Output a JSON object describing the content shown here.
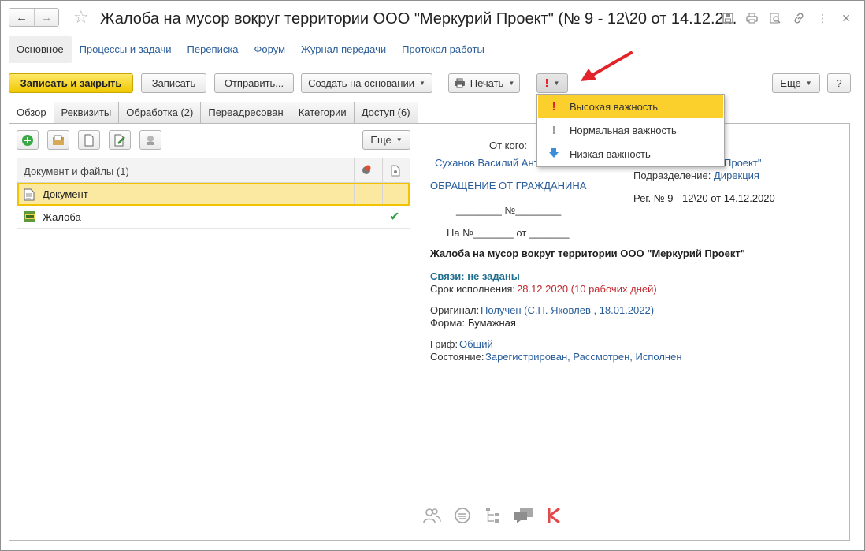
{
  "window": {
    "title": "Жалоба на мусор вокруг территории ООО \"Меркурий Проект\" (№ 9 - 12\\20 от 14.12.2..."
  },
  "section_tabs": [
    {
      "label": "Основное"
    },
    {
      "label": "Процессы и задачи"
    },
    {
      "label": "Переписка"
    },
    {
      "label": "Форум"
    },
    {
      "label": "Журнал передачи"
    },
    {
      "label": "Протокол работы"
    }
  ],
  "toolbar": {
    "save_close": "Записать и закрыть",
    "save": "Записать",
    "send": "Отправить...",
    "create_based": "Создать на основании",
    "print": "Печать",
    "importance_glyph": "!",
    "more": "Еще",
    "help": "?"
  },
  "importance_menu": {
    "items": [
      {
        "label": "Высокая важность",
        "icon": "exclamation-red-icon",
        "color": "#e0202a"
      },
      {
        "label": "Нормальная важность",
        "icon": "exclamation-gray-icon",
        "color": "#9a9a9a"
      },
      {
        "label": "Низкая важность",
        "icon": "arrow-down-blue-icon",
        "color": "#3a8fd8"
      }
    ]
  },
  "inner_tabs": [
    {
      "label": "Обзор"
    },
    {
      "label": "Реквизиты"
    },
    {
      "label": "Обработка (2)"
    },
    {
      "label": "Переадресован"
    },
    {
      "label": "Категории"
    },
    {
      "label": "Доступ (6)"
    }
  ],
  "files": {
    "more": "Еще",
    "header": "Документ и файлы (1)",
    "rows": [
      {
        "name": "Документ"
      },
      {
        "name": "Жалоба"
      }
    ]
  },
  "preview": {
    "from_label": "От кого:",
    "from_name": "Суханов Василий Ант",
    "org_partial": "Проект\"",
    "dept_label": "Подразделение:",
    "dept_value": "Дирекция",
    "appeal_type": "ОБРАЩЕНИЕ ОТ ГРАЖДАНИНА",
    "reg": "Рег. № 9 - 12\\20 от 14.12.2020",
    "num_line": "________ №________",
    "ref_line": "На №_______  от _______",
    "subject": "Жалоба на мусор вокруг территории ООО \"Меркурий Проект\"",
    "links": "Связи: не заданы",
    "deadline_label": "Срок исполнения:",
    "deadline_value": "28.12.2020 (10 рабочих дней)",
    "original_label": "Оригинал:",
    "original_value": "Получен (С.П. Яковлев , 18.01.2022)",
    "form_label": "Форма:",
    "form_value": "Бумажная",
    "grif_label": "Гриф:",
    "grif_value": "Общий",
    "state_label": "Состояние:",
    "state_value": "Зарегистрирован, Рассмотрен, Исполнен"
  },
  "bottom_icons": [
    "people-icon",
    "circle-lines-icon",
    "tree-icon",
    "chat-icon",
    "k-logo-icon"
  ],
  "colors": {
    "accent_yellow": "#f0c800",
    "link": "#2a5d9a",
    "red_arrow": "#e3222a"
  }
}
